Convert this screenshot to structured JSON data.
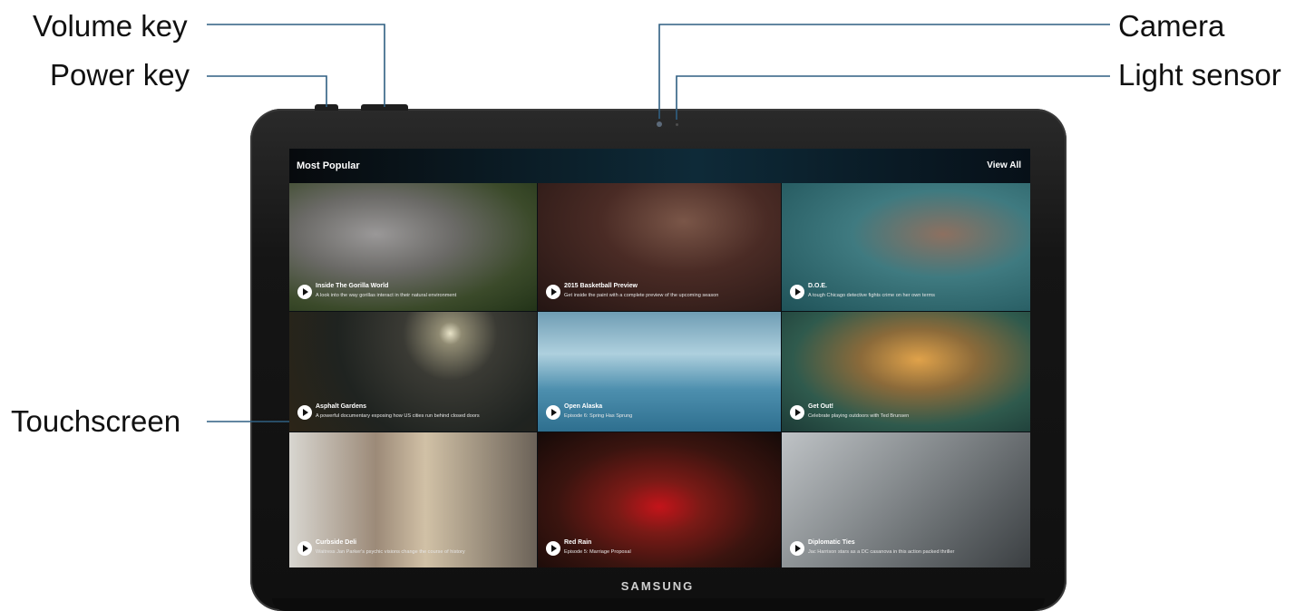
{
  "labels": {
    "volume_key": "Volume key",
    "power_key": "Power key",
    "touchscreen": "Touchscreen",
    "camera": "Camera",
    "light_sensor": "Light sensor"
  },
  "screen": {
    "header_title": "Most Popular",
    "view_all": "View All",
    "tiles": [
      {
        "title": "Inside The Gorilla World",
        "description": "A look into the way gorillas interact in their natural environment"
      },
      {
        "title": "2015 Basketball Preview",
        "description": "Get inside the paint with a complete preview of the upcoming season"
      },
      {
        "title": "D.O.E.",
        "description": "A tough Chicago detective fights crime on her own terms"
      },
      {
        "title": "Asphalt Gardens",
        "description": "A powerful documentary exposing how US cities run behind closed doors"
      },
      {
        "title": "Open Alaska",
        "description": "Episode 6: Spring Has Sprung"
      },
      {
        "title": "Get Out!",
        "description": "Celebrate playing outdoors with Ted Brunsen"
      },
      {
        "title": "Curbside Deli",
        "description": "Waitress Jan Parker's psychic visions change the course of history"
      },
      {
        "title": "Red Rain",
        "description": "Episode 5: Marriage Proposal"
      },
      {
        "title": "Diplomatic Ties",
        "description": "Jac Harrison stars as a DC casanova in this action packed thriller"
      }
    ]
  },
  "brand": "SAMSUNG",
  "colors": {
    "callout_line": "#2f5f82",
    "bezel": "#151515",
    "text": "#111111"
  }
}
